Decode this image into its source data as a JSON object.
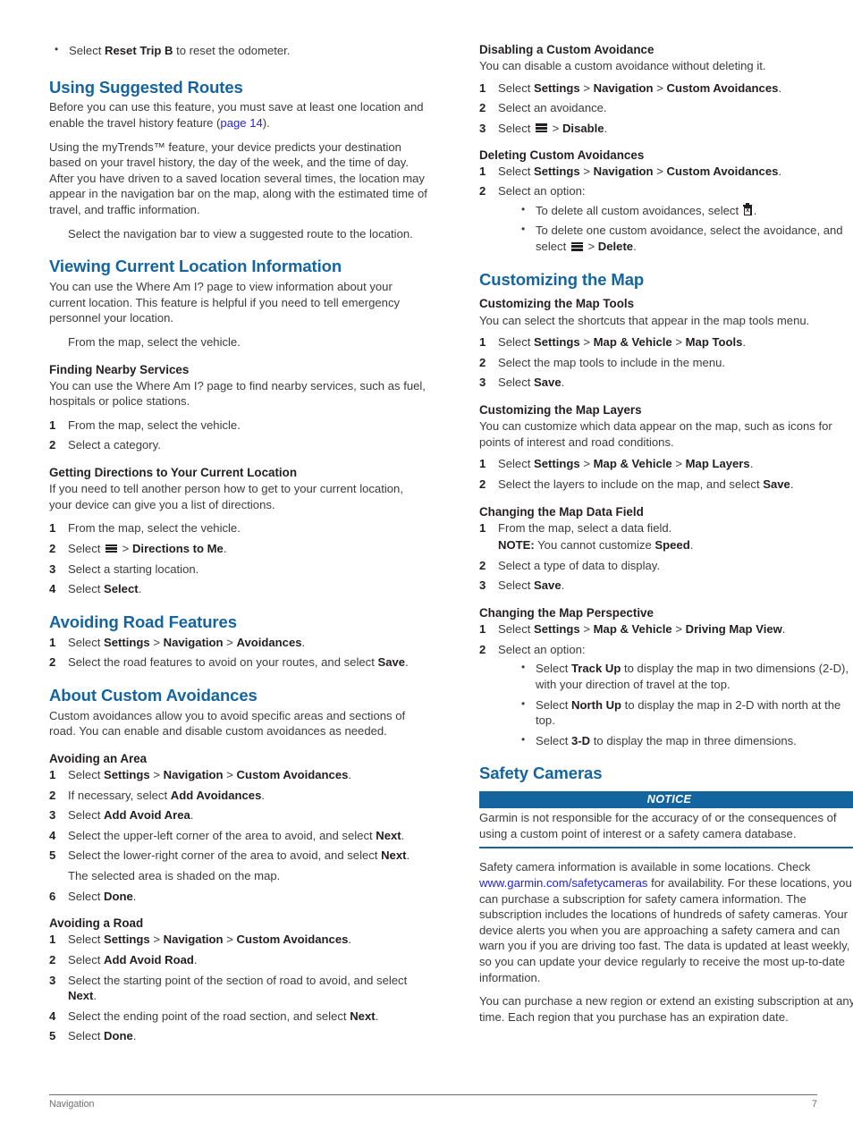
{
  "doc": {
    "footer_section": "Navigation",
    "page_number": "7"
  },
  "colors": {
    "heading_blue": "#1464a0",
    "link_blue": "#2323e0",
    "notice_blue": "#1464a0",
    "body_text": "#3b3b3c"
  },
  "left_column": {
    "top_bullet": {
      "prefix": "Select ",
      "bold": "Reset Trip B",
      "suffix": " to reset the odometer."
    },
    "using_suggested_routes": {
      "heading": "Using Suggested Routes",
      "para1_a": "Before you can use this feature, you must save at least one location and enable the travel history feature (",
      "para1_link": "page 14",
      "para1_b": ").",
      "para2": "Using the myTrends™ feature, your device predicts your destination based on your travel history, the day of the week, and the time of day. After you have driven to a saved location several times, the location may appear in the navigation bar on the map, along with the estimated time of travel, and traffic information.",
      "para3": "Select the navigation bar to view a suggested route to the location."
    },
    "viewing_current_location": {
      "heading": "Viewing Current Location Information",
      "para1": "You can use the Where Am I? page to view information about your current location. This feature is helpful if you need to tell emergency personnel your location.",
      "para2": "From the map, select the vehicle."
    },
    "finding_nearby_services": {
      "heading": "Finding Nearby Services",
      "para1": "You can use the Where Am I? page to find nearby services, such as fuel, hospitals or police stations.",
      "step1": "From the map, select the vehicle.",
      "step2": "Select a category."
    },
    "getting_directions": {
      "heading": "Getting Directions to Your Current Location",
      "para1": "If you need to tell another person how to get to your current location, your device can give you a list of directions.",
      "step1": "From the map, select the vehicle.",
      "step2_prefix": "Select ",
      "step2_sep": " > ",
      "step2_bold": "Directions to Me",
      "step2_suffix": ".",
      "step3": "Select a starting location.",
      "step4_prefix": "Select ",
      "step4_bold": "Select",
      "step4_suffix": "."
    },
    "avoiding_road_features": {
      "heading": "Avoiding Road Features",
      "step1_prefix": "Select ",
      "step1_b1": "Settings",
      "step1_s1": " > ",
      "step1_b2": "Navigation",
      "step1_s2": " > ",
      "step1_b3": "Avoidances",
      "step1_suffix": ".",
      "step2_prefix": "Select the road features to avoid on your routes, and select ",
      "step2_bold": "Save",
      "step2_suffix": "."
    },
    "about_custom_avoidances": {
      "heading": "About Custom Avoidances",
      "para1": "Custom avoidances allow you to avoid specific areas and sections of road. You can enable and disable custom avoidances as needed."
    },
    "avoiding_an_area": {
      "heading": "Avoiding an Area",
      "step1_prefix": "Select ",
      "step1_b1": "Settings",
      "step1_s1": " > ",
      "step1_b2": "Navigation",
      "step1_s2": " > ",
      "step1_b3": "Custom Avoidances",
      "step1_suffix": ".",
      "step2_prefix": "If necessary, select ",
      "step2_bold": "Add Avoidances",
      "step2_suffix": ".",
      "step3_prefix": "Select ",
      "step3_bold": "Add Avoid Area",
      "step3_suffix": ".",
      "step4_prefix": "Select the upper-left corner of the area to avoid, and select ",
      "step4_bold": "Next",
      "step4_suffix": ".",
      "step5_prefix": "Select the lower-right corner of the area to avoid, and select ",
      "step5_bold": "Next",
      "step5_suffix": ".",
      "step5_note": "The selected area is shaded on the map.",
      "step6_prefix": "Select ",
      "step6_bold": "Done",
      "step6_suffix": "."
    },
    "avoiding_a_road": {
      "heading": "Avoiding a Road",
      "step1_prefix": "Select ",
      "step1_b1": "Settings",
      "step1_s1": " > ",
      "step1_b2": "Navigation",
      "step1_s2": " > ",
      "step1_b3": "Custom Avoidances",
      "step1_suffix": ".",
      "step2_prefix": "Select ",
      "step2_bold": "Add Avoid Road",
      "step2_suffix": ".",
      "step3_prefix": "Select the starting point of the section of road to avoid, and select ",
      "step3_bold": "Next",
      "step3_suffix": ".",
      "step4_prefix": "Select the ending point of the road section, and select ",
      "step4_bold": "Next",
      "step4_suffix": ".",
      "step5_prefix": "Select ",
      "step5_bold": "Done",
      "step5_suffix": "."
    }
  },
  "right_column": {
    "disabling_custom_avoidance": {
      "heading": "Disabling a Custom Avoidance",
      "para1": "You can disable a custom avoidance without deleting it.",
      "step1_prefix": "Select ",
      "step1_b1": "Settings",
      "step1_s1": " > ",
      "step1_b2": "Navigation",
      "step1_s2": " > ",
      "step1_b3": "Custom Avoidances",
      "step1_suffix": ".",
      "step2": "Select an avoidance.",
      "step3_prefix": "Select ",
      "step3_sep": " > ",
      "step3_bold": "Disable",
      "step3_suffix": "."
    },
    "deleting_custom_avoidances": {
      "heading": "Deleting Custom Avoidances",
      "step1_prefix": "Select ",
      "step1_b1": "Settings",
      "step1_s1": " > ",
      "step1_b2": "Navigation",
      "step1_s2": " > ",
      "step1_b3": "Custom Avoidances",
      "step1_suffix": ".",
      "step2": "Select an option:",
      "bullet1_prefix": "To delete all custom avoidances, select ",
      "bullet1_suffix": ".",
      "bullet2_prefix": "To delete one custom avoidance, select the avoidance, and select ",
      "bullet2_sep": " > ",
      "bullet2_bold": "Delete",
      "bullet2_suffix": "."
    },
    "customizing_the_map": {
      "heading": "Customizing the Map"
    },
    "customizing_map_tools": {
      "heading": "Customizing the Map Tools",
      "para1": "You can select the shortcuts that appear in the map tools menu.",
      "step1_prefix": "Select ",
      "step1_b1": "Settings",
      "step1_s1": " > ",
      "step1_b2": "Map & Vehicle",
      "step1_s2": " > ",
      "step1_b3": "Map Tools",
      "step1_suffix": ".",
      "step2": "Select the map tools to include in the menu.",
      "step3_prefix": "Select ",
      "step3_bold": "Save",
      "step3_suffix": "."
    },
    "customizing_map_layers": {
      "heading": "Customizing the Map Layers",
      "para1": "You can customize which data appear on the map, such as icons for points of interest and road conditions.",
      "step1_prefix": "Select ",
      "step1_b1": "Settings",
      "step1_s1": " > ",
      "step1_b2": "Map & Vehicle",
      "step1_s2": " > ",
      "step1_b3": "Map Layers",
      "step1_suffix": ".",
      "step2_prefix": "Select the layers to include on the map, and select ",
      "step2_bold": "Save",
      "step2_suffix": "."
    },
    "changing_map_data_field": {
      "heading": "Changing the Map Data Field",
      "step1": "From the map, select a data field.",
      "note_label": "NOTE:",
      "note_text_a": " You cannot customize ",
      "note_bold": "Speed",
      "note_text_b": ".",
      "step2": "Select a type of data to display.",
      "step3_prefix": "Select ",
      "step3_bold": "Save",
      "step3_suffix": "."
    },
    "changing_map_perspective": {
      "heading": "Changing the Map Perspective",
      "step1_prefix": "Select ",
      "step1_b1": "Settings",
      "step1_s1": " > ",
      "step1_b2": "Map & Vehicle",
      "step1_s2": " > ",
      "step1_b3": "Driving Map View",
      "step1_suffix": ".",
      "step2": "Select an option:",
      "bullet1_prefix": "Select ",
      "bullet1_bold": "Track Up",
      "bullet1_suffix": " to display the map in two dimensions (2-D), with your direction of travel at the top.",
      "bullet2_prefix": "Select ",
      "bullet2_bold": "North Up",
      "bullet2_suffix": " to display the map in 2-D with north at the top.",
      "bullet3_prefix": "Select ",
      "bullet3_bold": "3-D",
      "bullet3_suffix": " to display the map in three dimensions."
    },
    "safety_cameras": {
      "heading": "Safety Cameras",
      "notice_label": "NOTICE",
      "notice_body": "Garmin is not responsible for the accuracy of or the consequences of using a custom point of interest or a safety camera database.",
      "para1_a": "Safety camera information is available in some locations. Check ",
      "para1_link": "www.garmin.com/safetycameras",
      "para1_b": " for availability. For these locations, you can purchase a subscription for safety camera information. The subscription includes the locations of hundreds of safety cameras. Your device alerts you when you are approaching a safety camera and can warn you if you are driving too fast. The data is updated at least weekly, so you can update your device regularly to receive the most up-to-date information.",
      "para2": "You can purchase a new region or extend an existing subscription at any time. Each region that you purchase has an expiration date."
    }
  }
}
